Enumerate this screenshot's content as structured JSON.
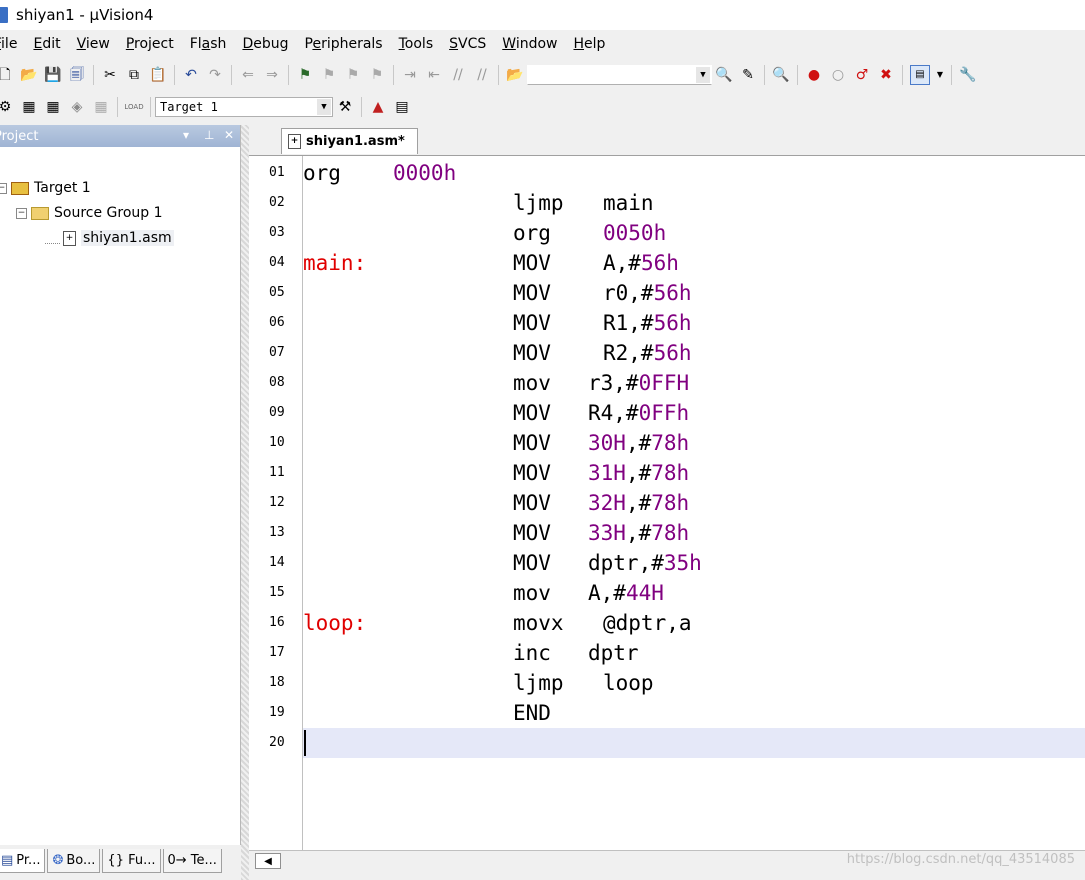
{
  "window": {
    "title": "shiyan1  - µVision4"
  },
  "menu": [
    {
      "label": "File",
      "u": "F"
    },
    {
      "label": "Edit",
      "u": "E"
    },
    {
      "label": "View",
      "u": "V"
    },
    {
      "label": "Project",
      "u": "P"
    },
    {
      "label": "Flash",
      "u": "a"
    },
    {
      "label": "Debug",
      "u": "D"
    },
    {
      "label": "Peripherals",
      "u": "e"
    },
    {
      "label": "Tools",
      "u": "T"
    },
    {
      "label": "SVCS",
      "u": "S"
    },
    {
      "label": "Window",
      "u": "W"
    },
    {
      "label": "Help",
      "u": "H"
    }
  ],
  "toolbar2": {
    "target_select": "Target 1",
    "load_label": "LOAD"
  },
  "project_panel": {
    "title": "Project",
    "tree": {
      "target": "Target 1",
      "group": "Source Group 1",
      "file": "shiyan1.asm"
    }
  },
  "bottom_tabs": [
    "Pr...",
    "Bo...",
    "{} Fu...",
    "0→ Te..."
  ],
  "editor": {
    "tab": "shiyan1.asm*",
    "lines": [
      {
        "n": "01",
        "label": "",
        "op": "org",
        "arg": "",
        "num": "0000h",
        "label_col": true
      },
      {
        "n": "02",
        "label": "",
        "op": "ljmp",
        "arg": "main",
        "num": ""
      },
      {
        "n": "03",
        "label": "",
        "op": "org",
        "arg": "",
        "num": "0050h"
      },
      {
        "n": "04",
        "label": "main:",
        "op": "MOV",
        "arg": "A,#",
        "num": "56h"
      },
      {
        "n": "05",
        "label": "",
        "op": "MOV",
        "arg": "r0,#",
        "num": "56h"
      },
      {
        "n": "06",
        "label": "",
        "op": "MOV",
        "arg": "R1,#",
        "num": "56h"
      },
      {
        "n": "07",
        "label": "",
        "op": "MOV",
        "arg": "R2,#",
        "num": "56h"
      },
      {
        "n": "08",
        "label": "",
        "op": "mov",
        "arg": "r3,#",
        "num": "0FFH"
      },
      {
        "n": "09",
        "label": "",
        "op": "MOV",
        "arg": "R4,#",
        "num": "0FFh"
      },
      {
        "n": "10",
        "label": "",
        "op": "MOV",
        "arg": "",
        "num": "30H",
        "arg2": ",#",
        "num2": "78h"
      },
      {
        "n": "11",
        "label": "",
        "op": "MOV",
        "arg": "",
        "num": "31H",
        "arg2": ",#",
        "num2": "78h"
      },
      {
        "n": "12",
        "label": "",
        "op": "MOV",
        "arg": "",
        "num": "32H",
        "arg2": ",#",
        "num2": "78h"
      },
      {
        "n": "13",
        "label": "",
        "op": "MOV",
        "arg": "",
        "num": "33H",
        "arg2": ",#",
        "num2": "78h"
      },
      {
        "n": "14",
        "label": "",
        "op": "MOV",
        "arg": "dptr,#",
        "num": "35h"
      },
      {
        "n": "15",
        "label": "",
        "op": "mov",
        "arg": "A,#",
        "num": "44H"
      },
      {
        "n": "16",
        "label": "loop:",
        "op": "movx",
        "arg": "@dptr,a",
        "num": ""
      },
      {
        "n": "17",
        "label": "",
        "op": "inc",
        "arg": "dptr",
        "num": ""
      },
      {
        "n": "18",
        "label": "",
        "op": "ljmp",
        "arg": "loop",
        "num": ""
      },
      {
        "n": "19",
        "label": "",
        "op": "END",
        "arg": "",
        "num": ""
      },
      {
        "n": "20",
        "label": "",
        "op": "",
        "arg": "",
        "num": ""
      }
    ]
  },
  "watermark": "https://blog.csdn.net/qq_43514085",
  "colors": {
    "label": "#e00000",
    "number": "#800080",
    "current_line": "#e5e8f8"
  }
}
